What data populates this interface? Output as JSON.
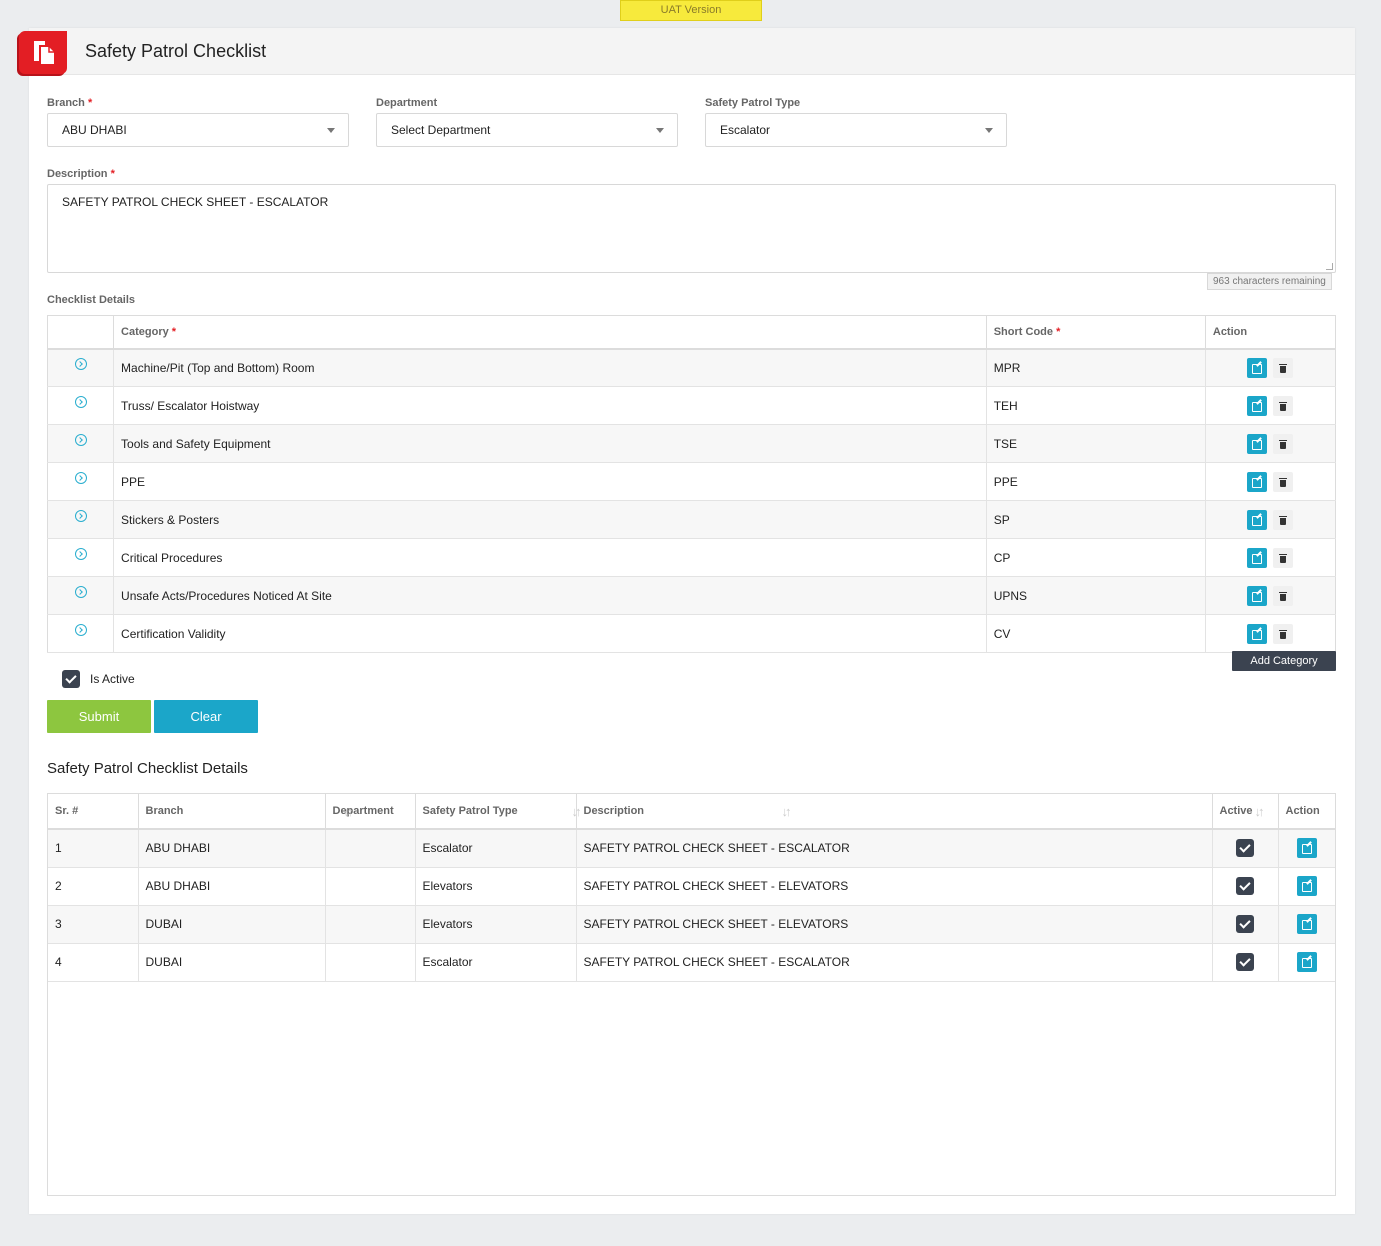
{
  "banner": {
    "text": "UAT Version"
  },
  "header": {
    "title": "Safety Patrol Checklist"
  },
  "form": {
    "branch": {
      "label": "Branch",
      "value": "ABU DHABI"
    },
    "department": {
      "label": "Department",
      "value": "Select Department"
    },
    "patrol_type": {
      "label": "Safety Patrol Type",
      "value": "Escalator"
    },
    "description": {
      "label": "Description",
      "value": "SAFETY PATROL CHECK SHEET - ESCALATOR",
      "chars_remaining": "963 characters remaining"
    },
    "required_mark": "*"
  },
  "checklist": {
    "title": "Checklist Details",
    "columns": {
      "category": "Category",
      "short_code": "Short Code",
      "action": "Action"
    },
    "rows": [
      {
        "category": "Machine/Pit (Top and Bottom) Room",
        "code": "MPR"
      },
      {
        "category": "Truss/ Escalator Hoistway",
        "code": "TEH"
      },
      {
        "category": "Tools and Safety Equipment",
        "code": "TSE"
      },
      {
        "category": "PPE",
        "code": "PPE"
      },
      {
        "category": "Stickers & Posters",
        "code": "SP"
      },
      {
        "category": "Critical Procedures",
        "code": "CP"
      },
      {
        "category": "Unsafe Acts/Procedures Noticed At Site",
        "code": "UPNS"
      },
      {
        "category": "Certification Validity",
        "code": "CV"
      }
    ],
    "add_button": "Add Category"
  },
  "is_active": {
    "label": "Is Active",
    "checked": true
  },
  "buttons": {
    "submit": "Submit",
    "clear": "Clear"
  },
  "details": {
    "title": "Safety Patrol Checklist Details",
    "columns": {
      "sr": "Sr. #",
      "branch": "Branch",
      "department": "Department",
      "type": "Safety Patrol Type",
      "description": "Description",
      "active": "Active",
      "action": "Action"
    },
    "rows": [
      {
        "sr": "1",
        "branch": "ABU DHABI",
        "department": "",
        "type": "Escalator",
        "description": "SAFETY PATROL CHECK SHEET - ESCALATOR",
        "active": true
      },
      {
        "sr": "2",
        "branch": "ABU DHABI",
        "department": "",
        "type": "Elevators",
        "description": "SAFETY PATROL CHECK SHEET - ELEVATORS",
        "active": true
      },
      {
        "sr": "3",
        "branch": "DUBAI",
        "department": "",
        "type": "Elevators",
        "description": "SAFETY PATROL CHECK SHEET - ELEVATORS",
        "active": true
      },
      {
        "sr": "4",
        "branch": "DUBAI",
        "department": "",
        "type": "Escalator",
        "description": "SAFETY PATROL CHECK SHEET - ESCALATOR",
        "active": true
      }
    ]
  },
  "colors": {
    "accent": "#1ba6c9",
    "submit": "#8dc63f",
    "dark": "#3b4350",
    "brand": "#e31e24",
    "banner": "#f7ea3c"
  },
  "icons": {
    "logo": "document-icon",
    "expand": "chevron-circle-right-icon",
    "edit": "edit-icon",
    "delete": "trash-icon",
    "sort": "sort-icon",
    "check": "check-icon"
  }
}
